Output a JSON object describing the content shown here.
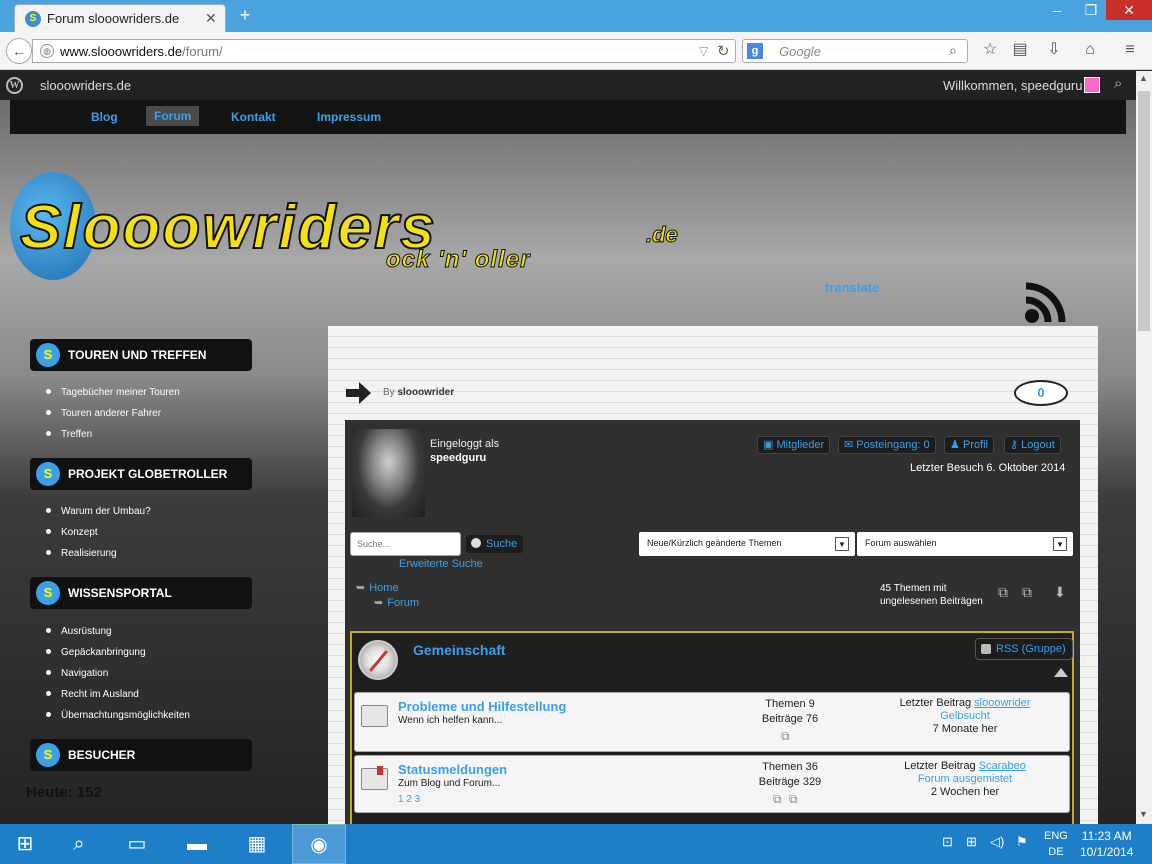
{
  "browser": {
    "tab_title": "Forum slooowriders.de",
    "url_domain": "www.slooowriders.de",
    "url_path": "/forum/",
    "search_placeholder": "Google",
    "minimize": "–",
    "maximize": "❐",
    "close": "✕",
    "new_tab": "+"
  },
  "adminbar": {
    "site_name": "slooowriders.de",
    "welcome": "Willkommen, speedguru"
  },
  "topmenu": [
    "Blog",
    "Forum",
    "Kontakt",
    "Impressum"
  ],
  "header": {
    "logo": "Slooowriders",
    "logo_suffix": ".de",
    "slogan": "ock  'n'  oller",
    "translate": "translate"
  },
  "sidebar": {
    "sections": [
      {
        "title": "TOUREN UND TREFFEN",
        "items": [
          "Tagebücher meiner Touren",
          "Touren anderer Fahrer",
          "Treffen"
        ]
      },
      {
        "title": "PROJEKT GLOBETROLLER",
        "items": [
          "Warum der Umbau?",
          "Konzept",
          "Realisierung"
        ]
      },
      {
        "title": "WISSENSPORTAL",
        "items": [
          "Ausrüstung",
          "Gepäckanbringung",
          "Navigation",
          "Recht im Ausland",
          "Übernachtungsmöglichkeiten"
        ]
      },
      {
        "title": "BESUCHER",
        "items": []
      }
    ],
    "visitors_today": "Heute: 152"
  },
  "post": {
    "by_label": "By",
    "author": "slooowrider",
    "comments": "0"
  },
  "forum": {
    "logged_in_label": "Eingeloggt als",
    "username": "speedguru",
    "user_buttons": [
      "Mitglieder",
      "Posteingang: 0",
      "Profil",
      "Logout"
    ],
    "last_visit": "Letzter Besuch 6. Oktober 2014",
    "search_placeholder": "Suche...",
    "search_button": "Suche",
    "advanced_search": "Erweiterte Suche",
    "select_topics": "Neue/Kürzlich geänderte Themen",
    "select_forum": "Forum auswählen",
    "breadcrumb": [
      "Home",
      "Forum"
    ],
    "unread_line1": "45 Themen mit",
    "unread_line2": "ungelesenen Beiträgen",
    "category_title": "Gemeinschaft",
    "rss_group": "RSS (Gruppe)",
    "forums": [
      {
        "title": "Probleme und Hilfestellung",
        "desc": "Wenn ich helfen kann...",
        "pages": "",
        "themes": "Themen 9",
        "posts": "Beiträge 76",
        "last_label": "Letzter Beitrag",
        "last_user": "slooowrider",
        "last_topic": "Gelbsucht",
        "last_time": "7 Monate her"
      },
      {
        "title": "Statusmeldungen",
        "desc": "Zum Blog und Forum...",
        "pages": "1  2  3",
        "themes": "Themen 36",
        "posts": "Beiträge 329",
        "last_label": "Letzter Beitrag",
        "last_user": "Scarabeo",
        "last_topic": "Forum ausgemistet",
        "last_time": "2 Wochen her"
      }
    ]
  },
  "taskbar": {
    "lang1": "ENG",
    "lang2": "DE",
    "time": "11:23 AM",
    "date": "10/1/2014"
  },
  "colors": {
    "accent": "#3ba0e8",
    "logo_yellow": "#f5e012",
    "titlebar": "#4aa3dc",
    "taskbar": "#1e7fc8"
  }
}
